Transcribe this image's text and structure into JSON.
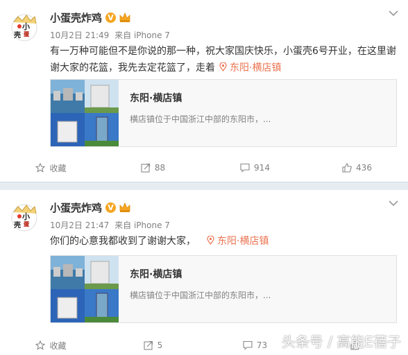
{
  "posts": [
    {
      "user": "小蛋壳炸鸡",
      "verified_mark": "V",
      "avatar_text": [
        "小",
        "蛋",
        "壳"
      ],
      "time": "10月2日 21:49",
      "source": "来自 iPhone 7",
      "text": "有一万种可能但不是你说的那一种，祝大家国庆快乐，小蛋壳6号开业，在这里谢谢大家的花篮，我先去定花篮了，走着",
      "location": "东阳·横店镇",
      "place_title": "东阳·横店镇",
      "place_desc": "横店镇位于中国浙江中部的东阳市，...",
      "actions": {
        "fav": "收藏",
        "repost": "88",
        "comment": "914",
        "like": "436"
      }
    },
    {
      "user": "小蛋壳炸鸡",
      "verified_mark": "V",
      "avatar_text": [
        "小",
        "蛋",
        "壳"
      ],
      "time": "10月2日 21:47",
      "source": "来自 iPhone 7",
      "text": "你们的心意我都收到了谢谢大家，",
      "location": "东阳·横店镇",
      "place_title": "东阳·横店镇",
      "place_desc": "横店镇位于中国浙江中部的东阳市，...",
      "actions": {
        "fav": "收藏",
        "repost": "5",
        "comment": "73",
        "like": ""
      }
    }
  ],
  "watermark": "头条号 / 高能E蓓子",
  "colors": {
    "accent": "#eb7350",
    "meta": "#808080",
    "separator": "#e6ecf0",
    "vip": "#f5a623"
  }
}
